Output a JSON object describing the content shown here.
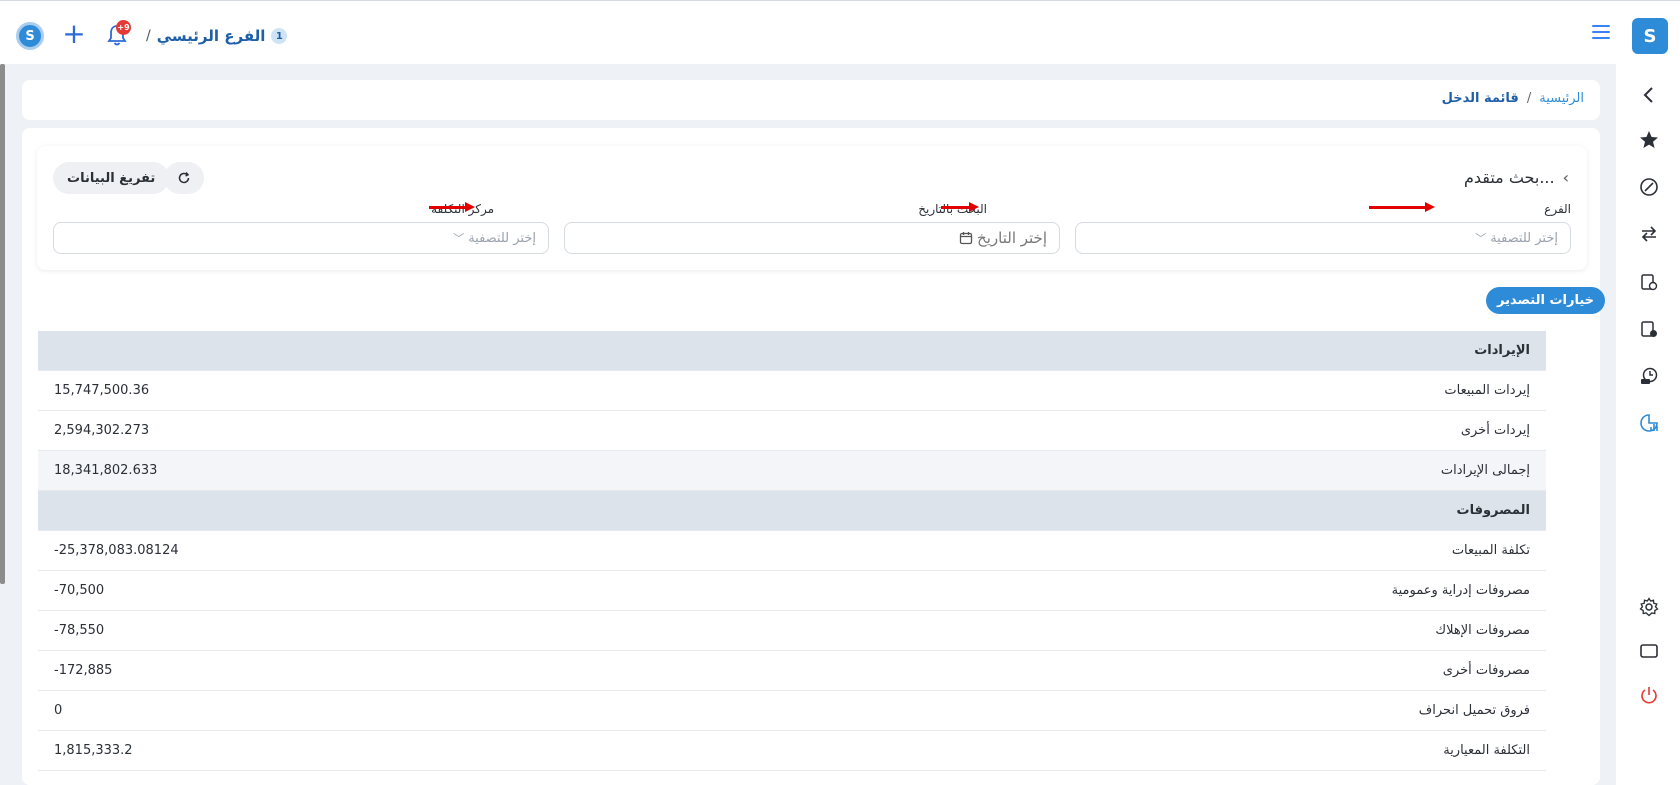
{
  "topbar": {
    "branch_name": "الفرع الرئيسي",
    "branch_separator": "/",
    "branch_count": "1",
    "notification_badge": "+9"
  },
  "breadcrumb": {
    "home": "الرئيسية",
    "separator": "/",
    "current": "قائمة الدخل"
  },
  "search": {
    "title": "بحث متقدم...",
    "clear_button": "تفريغ البيانات",
    "refresh_icon": "refresh-icon",
    "fields": {
      "branch": {
        "label": "الفرع",
        "placeholder": "إختر للتصفية"
      },
      "date": {
        "label": "البحث بالتاريخ",
        "placeholder": "إختر التاريخ"
      },
      "cost_center": {
        "label": "مركز التكلفة",
        "placeholder": "إختر للتصفية"
      }
    }
  },
  "export_button": "خيارات التصدير",
  "report": {
    "rows": [
      {
        "type": "section",
        "label": "الإيرادات",
        "value": ""
      },
      {
        "type": "item",
        "label": "إيردات المبيعات",
        "value": "15,747,500.36"
      },
      {
        "type": "item",
        "label": "إيردات أخرى",
        "value": "2,594,302.273"
      },
      {
        "type": "total",
        "label": "إجمالى الإيرادات",
        "value": "18,341,802.633"
      },
      {
        "type": "section",
        "label": "المصروفات",
        "value": ""
      },
      {
        "type": "item",
        "label": "تكلفة المبيعات",
        "value": "-25,378,083.08124"
      },
      {
        "type": "item",
        "label": "مصروفات إدراية وعمومية",
        "value": "-70,500"
      },
      {
        "type": "item",
        "label": "مصروفات الإهلاك",
        "value": "-78,550"
      },
      {
        "type": "item",
        "label": "مصروفات أخرى",
        "value": "-172,885"
      },
      {
        "type": "item",
        "label": "فروق تحميل انحراف",
        "value": "0"
      },
      {
        "type": "item",
        "label": "التكلفة المعيارية",
        "value": "1,815,333.2"
      }
    ]
  },
  "sidebar_icons": [
    "chevron-left-icon",
    "star-icon",
    "compass-icon",
    "transfer-icon",
    "invoice-icon",
    "document-clock-icon",
    "history-icon",
    "report-chart-icon",
    "settings-icon",
    "window-icon",
    "power-icon"
  ],
  "colors": {
    "accent": "#2e8bd8",
    "arrow": "#e00000",
    "section_bg": "#dce3ea",
    "power": "#e53935"
  }
}
